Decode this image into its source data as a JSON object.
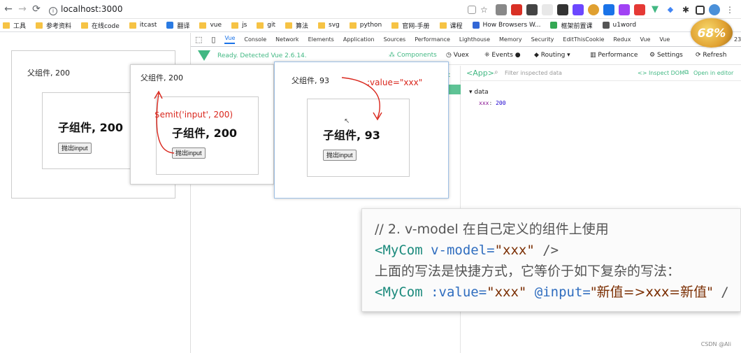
{
  "browser": {
    "url": "localhost:3000",
    "back_icon": "arrow-left",
    "forward_icon": "arrow-right",
    "reload_icon": "reload",
    "info_icon": "info-circle",
    "zoom_badge": "68%",
    "edge_label": "23"
  },
  "bookmarks": [
    {
      "label": "工具",
      "kind": "folder"
    },
    {
      "label": "参考资料",
      "kind": "folder"
    },
    {
      "label": "在线code",
      "kind": "folder"
    },
    {
      "label": "itcast",
      "kind": "folder"
    },
    {
      "label": "翻译",
      "kind": "app",
      "color": "#2a7ae2"
    },
    {
      "label": "vue",
      "kind": "folder"
    },
    {
      "label": "js",
      "kind": "folder"
    },
    {
      "label": "git",
      "kind": "folder"
    },
    {
      "label": "算法",
      "kind": "folder"
    },
    {
      "label": "svg",
      "kind": "folder"
    },
    {
      "label": "python",
      "kind": "folder"
    },
    {
      "label": "官网-手册",
      "kind": "folder"
    },
    {
      "label": "课程",
      "kind": "folder"
    },
    {
      "label": "How Browsers W...",
      "kind": "app",
      "color": "#3367d6"
    },
    {
      "label": "框架前置课",
      "kind": "app",
      "color": "#34a853"
    },
    {
      "label": "u1word",
      "kind": "app",
      "color": "#555555"
    }
  ],
  "app_left": {
    "parent_title": "父组件, 200",
    "child_title": "子组件, 200",
    "button_label": "抛出input"
  },
  "devtools": {
    "tabs": [
      "Vue",
      "Console",
      "Network",
      "Elements",
      "Application",
      "Sources",
      "Performance",
      "Lighthouse",
      "Memory",
      "Security",
      "EditThisCookie",
      "Redux",
      "Vue",
      "Vue"
    ],
    "active_tab": "Vue",
    "vue_status": "Ready. Detected Vue 2.6.14.",
    "components_label": "Components",
    "vuex_label": "Vuex",
    "events_label": "Events",
    "routing_label": "Routing",
    "performance_label": "Performance",
    "settings_label": "Settings",
    "refresh_label": "Refresh",
    "inspector_tag": "<App>",
    "filter_placeholder": "Filter inspected data",
    "inspect_dom": "<> Inspect DOM",
    "open_in_editor": "Open in editor",
    "data_label": "data",
    "data_key": "xxx",
    "data_value": "200",
    "cut_off_text": "ot"
  },
  "window_middle": {
    "parent_title": "父组件, 200",
    "child_title": "子组件, 200",
    "button_label": "抛出input",
    "annotation": "$emit('input', 200)"
  },
  "window_right": {
    "parent_title": "父组件, 93",
    "child_title": "子组件, 93",
    "button_label": "抛出input",
    "annotation": ":value=\"xxx\""
  },
  "code": {
    "line1": "// 2. v-model 在自己定义的组件上使用",
    "line2_tag_open": "<MyCom",
    "line2_attr": " v-model=",
    "line2_str": "\"xxx\"",
    "line2_close": " />",
    "line3": "上面的写法是快捷方式，它等价于如下复杂的写法：",
    "line4_tag_open": "<MyCom",
    "line4_attr1": " :value=",
    "line4_str1": "\"xxx\"",
    "line4_attr2": " @input=",
    "line4_str2": "\"新值=>xxx=新值\"",
    "line4_close": " /"
  },
  "footer": "CSDN @Ali",
  "colors": {
    "vue_green": "#42b883",
    "annotation_red": "#d9261c",
    "link_blue": "#1a73e8"
  }
}
